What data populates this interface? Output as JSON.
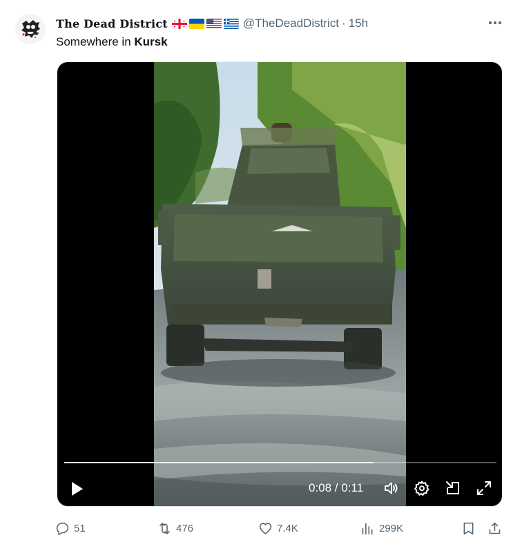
{
  "tweet": {
    "display_name": "The Dead District",
    "flags": [
      "georgia-flag-icon",
      "ukraine-flag-icon",
      "usa-flag-icon",
      "greece-flag-icon"
    ],
    "handle": "@TheDeadDistrict",
    "separator": "·",
    "timestamp": "15h",
    "text_prefix": "Somewhere in ",
    "text_bold": "Kursk"
  },
  "video": {
    "current_time": "0:08",
    "duration": "0:11",
    "time_display": "0:08 / 0:11",
    "progress": 0.715
  },
  "actions": {
    "replies": "51",
    "reposts": "476",
    "likes": "7.4K",
    "views": "299K"
  },
  "colors": {
    "text_primary": "#0f1419",
    "text_secondary": "#536471",
    "video_background": "#000000"
  }
}
